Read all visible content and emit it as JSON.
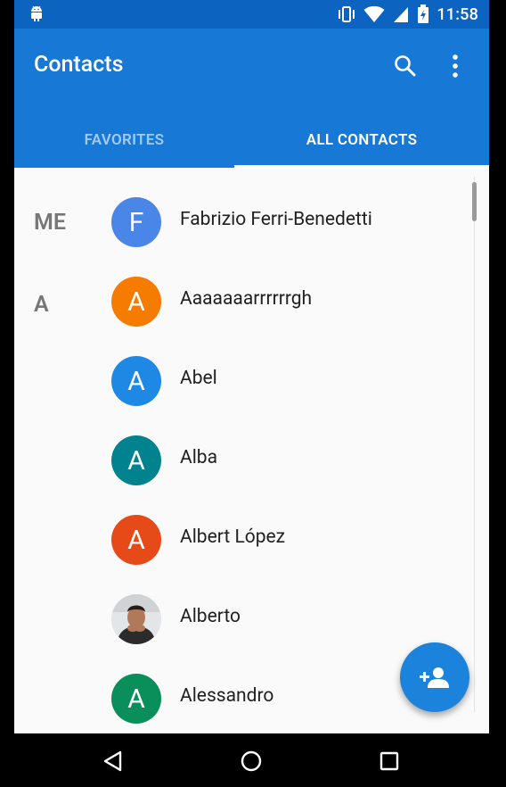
{
  "status_bar": {
    "time": "11:58",
    "icons": [
      "android-icon",
      "vibrate-icon",
      "wifi-icon",
      "cell-signal-icon",
      "battery-icon"
    ]
  },
  "app_bar": {
    "title": "Contacts",
    "actions": [
      "search-icon",
      "more-vert-icon"
    ]
  },
  "tabs": [
    {
      "label": "FAVORITES",
      "selected": false
    },
    {
      "label": "ALL CONTACTS",
      "selected": true
    }
  ],
  "sections": {
    "me": "ME",
    "a": "A"
  },
  "contacts": [
    {
      "name": "Fabrizio Ferri-Benedetti",
      "initial": "F",
      "color": "#4a86e8"
    },
    {
      "name": "Aaaaaaarrrrrrgh",
      "initial": "A",
      "color": "#f57c00"
    },
    {
      "name": "Abel",
      "initial": "A",
      "color": "#1e88e5"
    },
    {
      "name": "Alba",
      "initial": "A",
      "color": "#00838f"
    },
    {
      "name": "Albert López",
      "initial": "A",
      "color": "#e64a19"
    },
    {
      "name": "Alberto",
      "initial": "",
      "color": "#cfd8dc",
      "photo": true
    },
    {
      "name": "Alessandro",
      "initial": "A",
      "color": "#0a8f5a"
    }
  ],
  "fab": {
    "icon": "add-person-icon"
  },
  "nav_bar": {
    "buttons": [
      "back-icon",
      "home-icon",
      "recents-icon"
    ]
  }
}
